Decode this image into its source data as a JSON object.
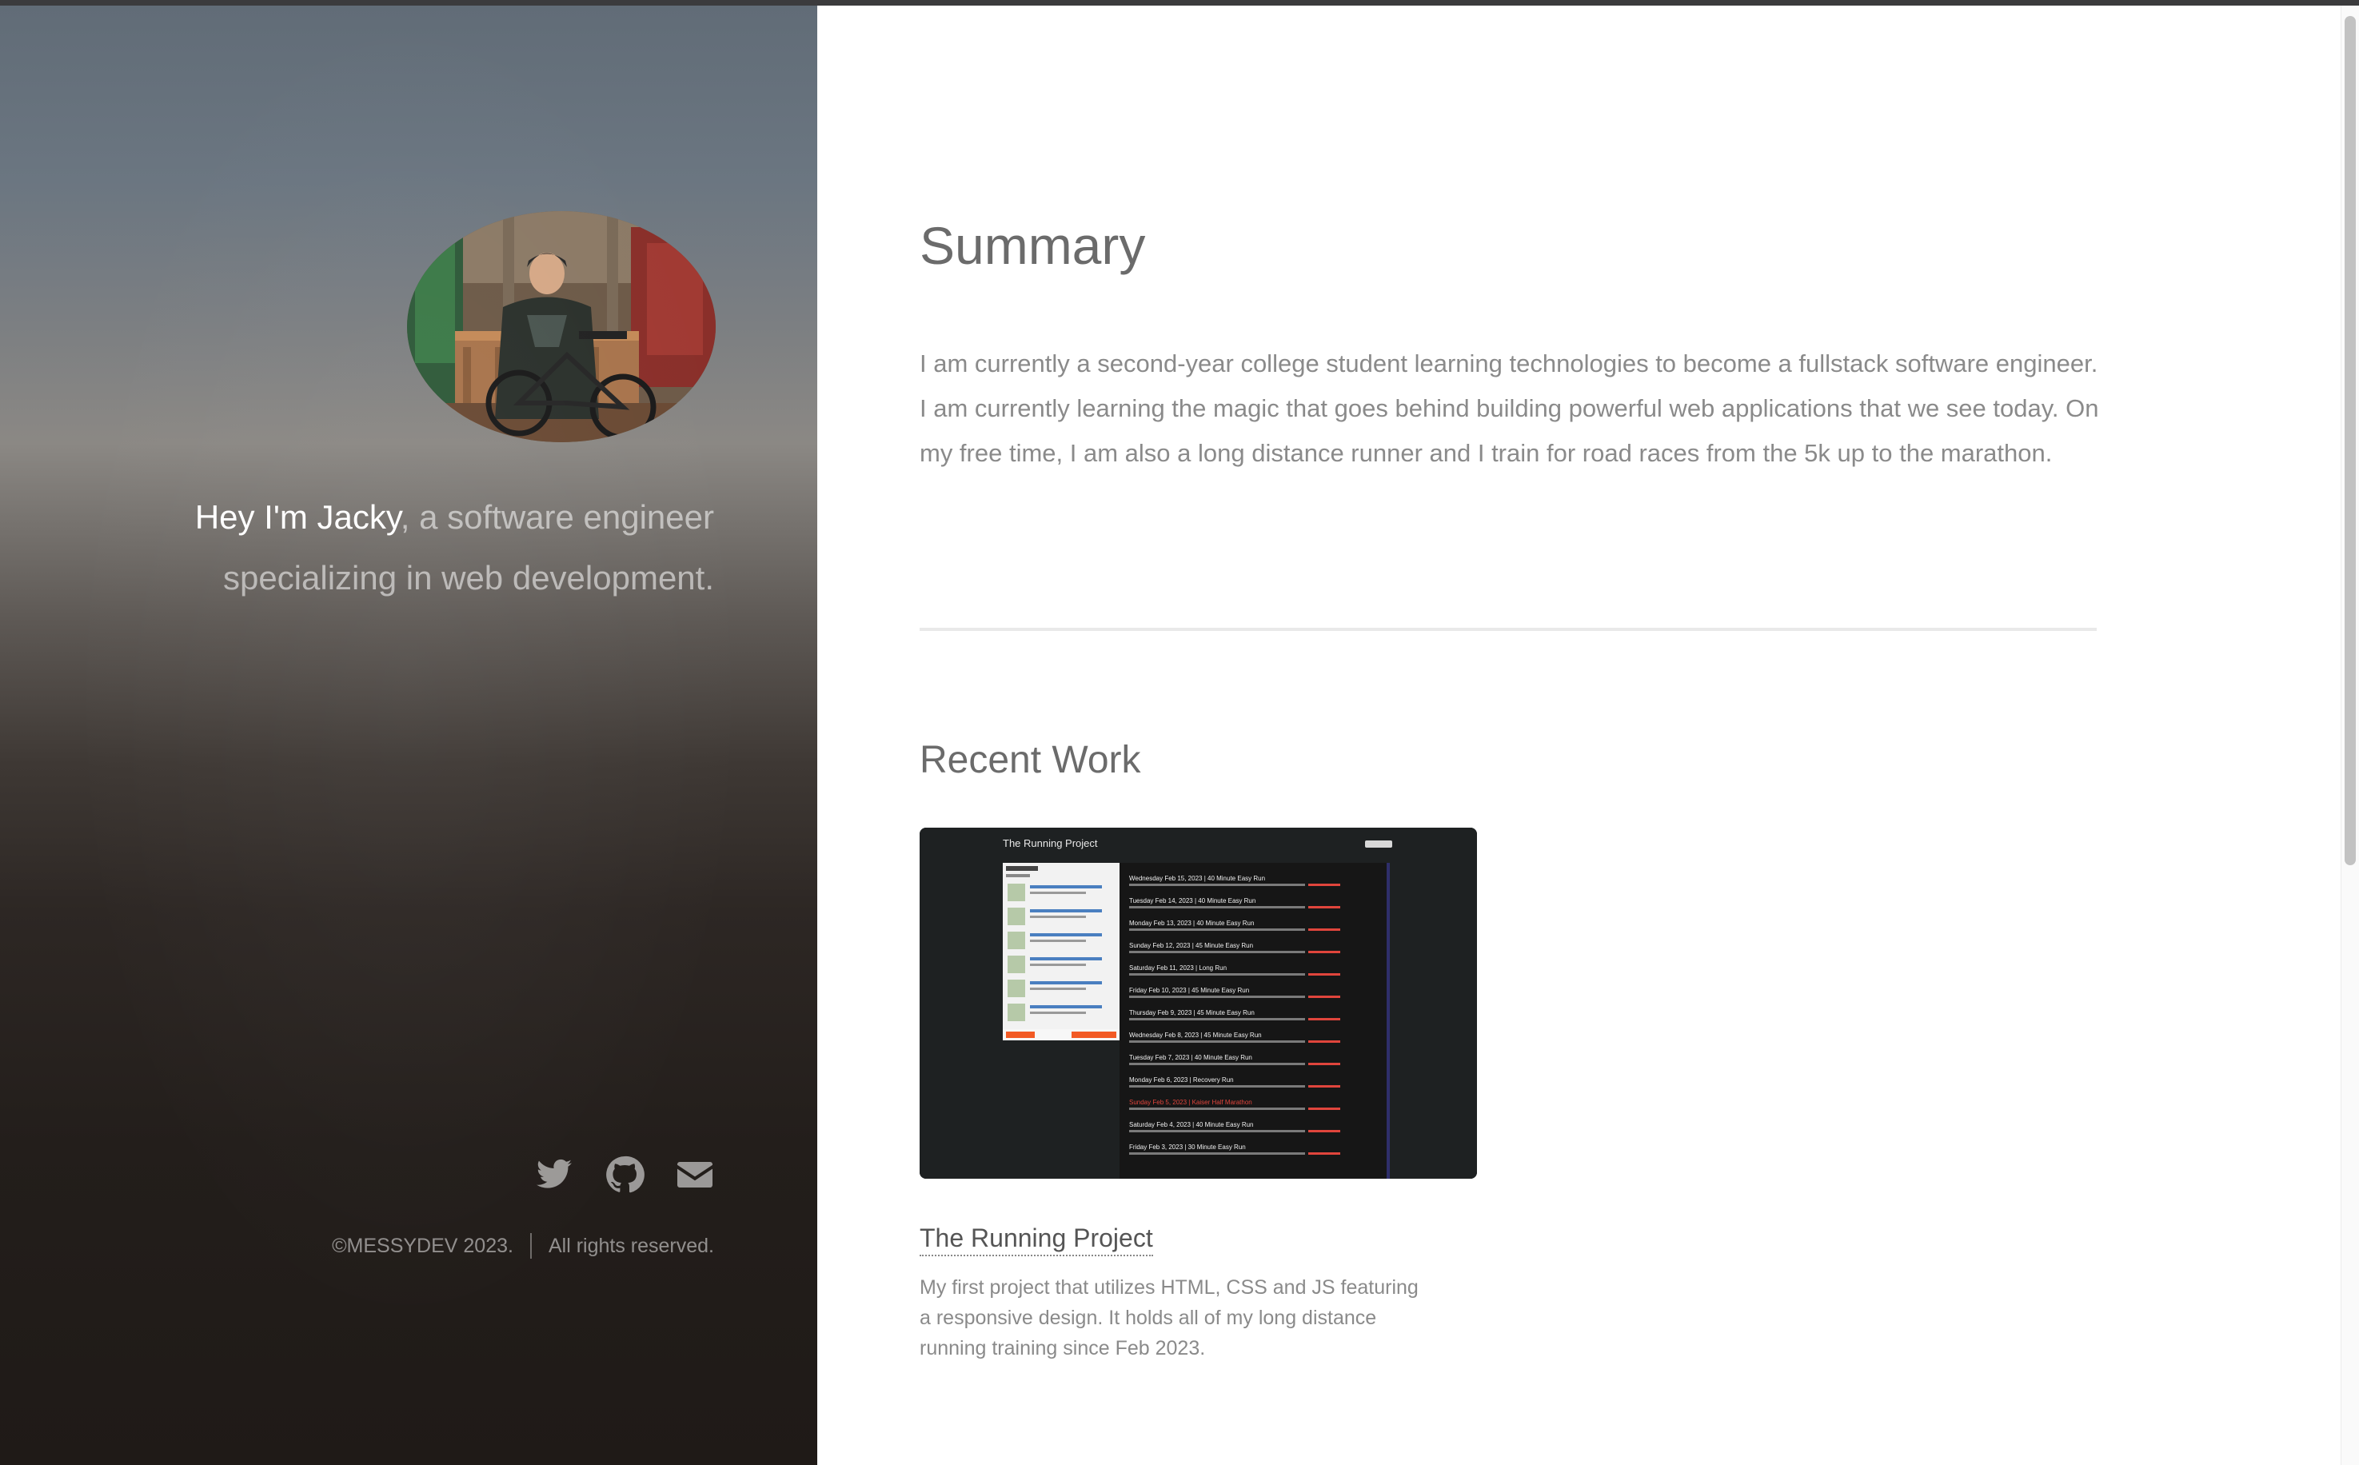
{
  "sidebar": {
    "intro_strong": "Hey I'm Jacky",
    "intro_rest": ", a software engineer specializing in web development.",
    "social": [
      "twitter-icon",
      "github-icon",
      "envelope-icon"
    ],
    "copyright": "©MESSYDEV 2023.",
    "rights": "All rights reserved."
  },
  "main": {
    "summary_heading": "Summary",
    "summary_text": "I am currently a second-year college student learning technologies to become a fullstack software engineer. I am currently learning the magic that goes behind building powerful web applications that we see today. On my free time, I am also a long distance runner and I train for road races from the 5k up to the marathon.",
    "recent_heading": "Recent Work",
    "project": {
      "title": "The Running Project",
      "description": "My first project that utilizes HTML, CSS and JS featuring a responsive design. It holds all of my long distance running training since Feb 2023.",
      "screenshot": {
        "title": "The Running Project",
        "entries": [
          "Wednesday Feb 15, 2023 | 40 Minute Easy Run",
          "Tuesday Feb 14, 2023 | 40 Minute Easy Run",
          "Monday Feb 13, 2023 | 40 Minute Easy Run",
          "Sunday Feb 12, 2023 | 45 Minute Easy Run",
          "Saturday Feb 11, 2023 | Long Run",
          "Friday Feb 10, 2023 | 45 Minute Easy Run",
          "Thursday Feb 9, 2023 | 45 Minute Easy Run",
          "Wednesday Feb 8, 2023 | 45 Minute Easy Run",
          "Tuesday Feb 7, 2023 | 40 Minute Easy Run",
          "Monday Feb 6, 2023 | Recovery Run",
          "Sunday Feb 5, 2023 | Kaiser Half Marathon",
          "Saturday Feb 4, 2023 | 40 Minute Easy Run",
          "Friday Feb 3, 2023 | 30 Minute Easy Run"
        ]
      }
    }
  },
  "colors": {
    "sidebar_top": "#616c77",
    "sidebar_bottom": "#1f1a17",
    "heading": "#6b6b6b",
    "body_text": "#8a8a8a",
    "accent_red": "#e0453c"
  }
}
